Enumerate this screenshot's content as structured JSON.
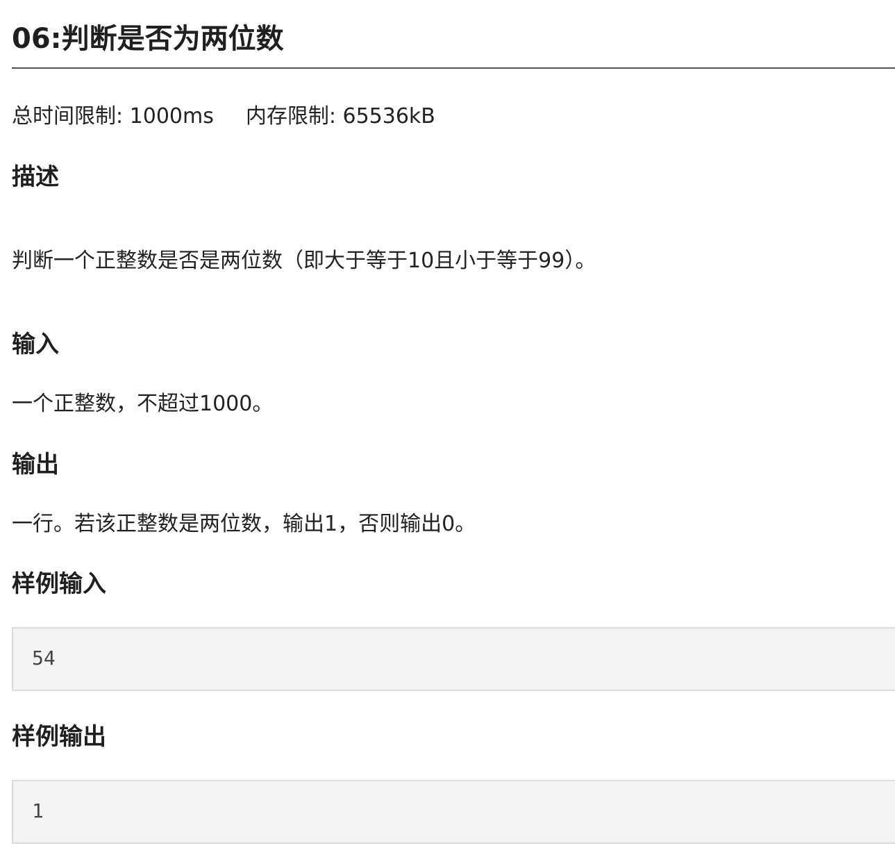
{
  "problem": {
    "title": "06:判断是否为两位数"
  },
  "limits": {
    "time": "总时间限制: 1000ms",
    "memory": "内存限制: 65536kB"
  },
  "sections": {
    "description": {
      "heading": "描述",
      "text": "判断一个正整数是否是两位数（即大于等于10且小于等于99）。"
    },
    "input": {
      "heading": "输入",
      "text": "一个正整数，不超过1000。"
    },
    "output": {
      "heading": "输出",
      "text": "一行。若该正整数是两位数，输出1，否则输出0。"
    },
    "sample_input": {
      "heading": "样例输入",
      "content": "54"
    },
    "sample_output": {
      "heading": "样例输出",
      "content": "1"
    }
  }
}
